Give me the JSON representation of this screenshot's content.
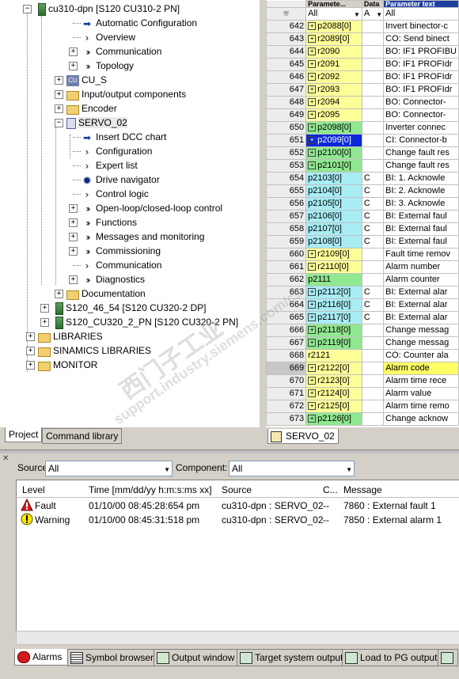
{
  "tree": {
    "nodes": [
      {
        "label": "cu310-dpn [S120 CU310-2 PN]",
        "icon": "drive-unit-icon"
      },
      {
        "label": "Automatic Configuration",
        "icon": "wizard-arrow-icon"
      },
      {
        "label": "Overview",
        "icon": "chevron-icon"
      },
      {
        "label": "Communication",
        "icon": "double-chevron-icon"
      },
      {
        "label": "Topology",
        "icon": "double-chevron-icon"
      },
      {
        "label": "CU_S",
        "icon": "control-unit-icon"
      },
      {
        "label": "Input/output components",
        "icon": "folder-icon"
      },
      {
        "label": "Encoder",
        "icon": "folder-icon"
      },
      {
        "label": "SERVO_02",
        "icon": "servo-drive-icon"
      },
      {
        "label": "Insert DCC chart",
        "icon": "wizard-arrow-icon"
      },
      {
        "label": "Configuration",
        "icon": "chevron-icon"
      },
      {
        "label": "Expert list",
        "icon": "chevron-icon"
      },
      {
        "label": "Drive navigator",
        "icon": "gear-icon"
      },
      {
        "label": "Control logic",
        "icon": "chevron-icon"
      },
      {
        "label": "Open-loop/closed-loop control",
        "icon": "double-chevron-icon"
      },
      {
        "label": "Functions",
        "icon": "double-chevron-icon"
      },
      {
        "label": "Messages and monitoring",
        "icon": "double-chevron-icon"
      },
      {
        "label": "Commissioning",
        "icon": "double-chevron-icon"
      },
      {
        "label": "Communication",
        "icon": "chevron-icon"
      },
      {
        "label": "Diagnostics",
        "icon": "double-chevron-icon"
      },
      {
        "label": "Documentation",
        "icon": "folder-icon"
      },
      {
        "label": "S120_46_54 [S120 CU320-2 DP]",
        "icon": "drive-unit-icon"
      },
      {
        "label": "S120_CU320_2_PN [S120 CU320-2 PN]",
        "icon": "drive-unit-icon"
      },
      {
        "label": "LIBRARIES",
        "icon": "folder-icon"
      },
      {
        "label": "SINAMICS LIBRARIES",
        "icon": "folder-icon"
      },
      {
        "label": "MONITOR",
        "icon": "folder-icon"
      }
    ],
    "tabs": [
      "Project",
      "Command library"
    ]
  },
  "expert": {
    "header": {
      "param": "Paramete...",
      "bdata": "Data",
      "text": "Parameter text"
    },
    "filter": {
      "param": "All",
      "bdata": "A",
      "text": "All"
    },
    "rows": [
      {
        "n": "642",
        "p": "p2088[0]",
        "c": "",
        "t": "Invert binector-c"
      },
      {
        "n": "643",
        "p": "r2089[0]",
        "c": "",
        "t": "CO: Send binect"
      },
      {
        "n": "644",
        "p": "r2090",
        "c": "",
        "t": "BO: IF1 PROFIBU"
      },
      {
        "n": "645",
        "p": "r2091",
        "c": "",
        "t": "BO: IF1 PROFIdr"
      },
      {
        "n": "646",
        "p": "r2092",
        "c": "",
        "t": "BO: IF1 PROFIdr"
      },
      {
        "n": "647",
        "p": "r2093",
        "c": "",
        "t": "BO: IF1 PROFIdr"
      },
      {
        "n": "648",
        "p": "r2094",
        "c": "",
        "t": "BO: Connector-"
      },
      {
        "n": "649",
        "p": "r2095",
        "c": "",
        "t": "BO: Connector-"
      },
      {
        "n": "650",
        "p": "p2098[0]",
        "c": "",
        "t": "Inverter connec"
      },
      {
        "n": "651",
        "p": "p2099[0]",
        "c": "",
        "t": "CI: Connector-b"
      },
      {
        "n": "652",
        "p": "p2100[0]",
        "c": "",
        "t": "Change fault res"
      },
      {
        "n": "653",
        "p": "p2101[0]",
        "c": "",
        "t": "Change fault res"
      },
      {
        "n": "654",
        "p": "p2103[0]",
        "c": "C",
        "t": "BI: 1. Acknowle"
      },
      {
        "n": "655",
        "p": "p2104[0]",
        "c": "C",
        "t": "BI: 2. Acknowle"
      },
      {
        "n": "656",
        "p": "p2105[0]",
        "c": "C",
        "t": "BI: 3. Acknowle"
      },
      {
        "n": "657",
        "p": "p2106[0]",
        "c": "C",
        "t": "BI: External faul"
      },
      {
        "n": "658",
        "p": "p2107[0]",
        "c": "C",
        "t": "BI: External faul"
      },
      {
        "n": "659",
        "p": "p2108[0]",
        "c": "C",
        "t": "BI: External faul"
      },
      {
        "n": "660",
        "p": "r2109[0]",
        "c": "",
        "t": "Fault time remov"
      },
      {
        "n": "661",
        "p": "r2110[0]",
        "c": "",
        "t": "Alarm number"
      },
      {
        "n": "662",
        "p": "p2111",
        "c": "",
        "t": "Alarm counter"
      },
      {
        "n": "663",
        "p": "p2112[0]",
        "c": "C",
        "t": "BI: External alar"
      },
      {
        "n": "664",
        "p": "p2116[0]",
        "c": "C",
        "t": "BI: External alar"
      },
      {
        "n": "665",
        "p": "p2117[0]",
        "c": "C",
        "t": "BI: External alar"
      },
      {
        "n": "666",
        "p": "p2118[0]",
        "c": "",
        "t": "Change messag"
      },
      {
        "n": "667",
        "p": "p2119[0]",
        "c": "",
        "t": "Change messag"
      },
      {
        "n": "668",
        "p": "r2121",
        "c": "",
        "t": "CO: Counter ala"
      },
      {
        "n": "669",
        "p": "r2122[0]",
        "c": "",
        "t": "Alarm code"
      },
      {
        "n": "670",
        "p": "r2123[0]",
        "c": "",
        "t": "Alarm time rece"
      },
      {
        "n": "671",
        "p": "r2124[0]",
        "c": "",
        "t": "Alarm value"
      },
      {
        "n": "672",
        "p": "r2125[0]",
        "c": "",
        "t": "Alarm time remo"
      },
      {
        "n": "673",
        "p": "p2126[0]",
        "c": "",
        "t": "Change acknow"
      }
    ],
    "tab": "SERVO_02"
  },
  "alarms": {
    "source_label": "Source:",
    "source_value": "All",
    "component_label": "Component:",
    "component_value": "All",
    "columns": [
      "Level",
      "Time [mm/dd/yy  h:m:s:ms xx]",
      "Source",
      "C...",
      "Message"
    ],
    "rows": [
      {
        "level": "Fault",
        "time": "01/10/00    08:45:28:654 pm",
        "source": "cu310-dpn : SERVO_02",
        "c": "--",
        "message": "7860 : External fault 1"
      },
      {
        "level": "Warning",
        "time": "01/10/00    08:45:31:518 pm",
        "source": "cu310-dpn : SERVO_02",
        "c": "--",
        "message": "7850 : External alarm 1"
      }
    ],
    "tabs": [
      "Alarms",
      "Symbol browser",
      "Output window",
      "Target system output",
      "Load to PG output"
    ]
  },
  "watermark": {
    "line1": "西门子工业",
    "line2": "support.industry.siemens.com/cs"
  }
}
